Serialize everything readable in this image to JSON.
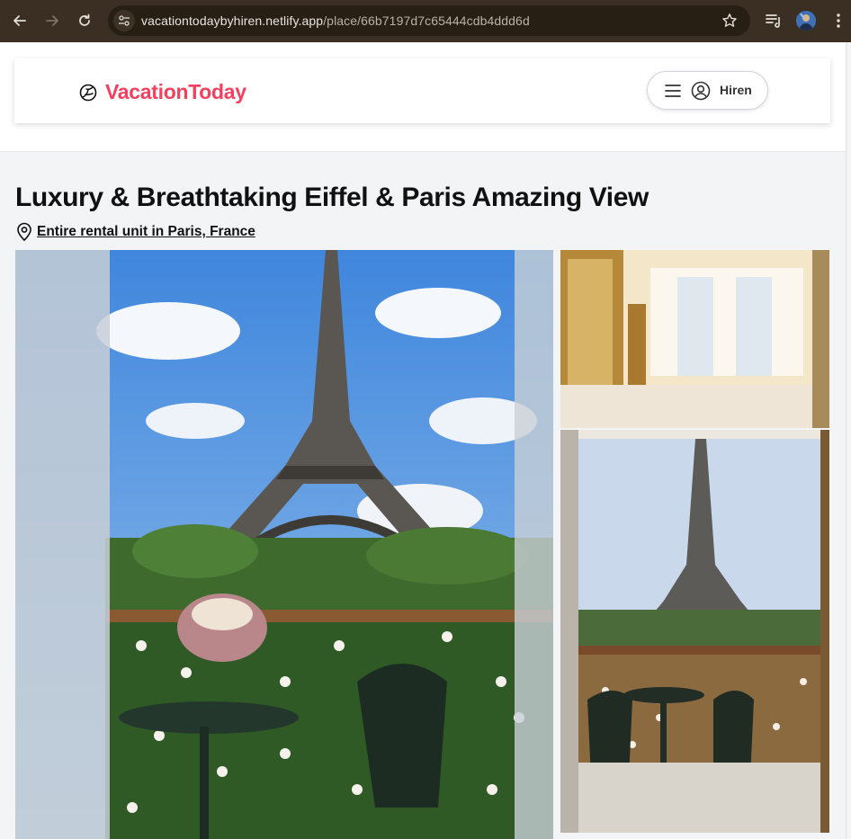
{
  "browser": {
    "url_host": "vacationtodaybyhiren.netlify.app",
    "url_path": "/place/66b7197d7c65444cdb4ddd6d"
  },
  "header": {
    "brand": "VacationToday",
    "user_name": "Hiren"
  },
  "place": {
    "title": "Luxury & Breathtaking Eiffel & Paris Amazing View",
    "address": "Entire rental unit in Paris, France"
  },
  "colors": {
    "brand": "#f43f5e",
    "chrome": "#3a2f22"
  }
}
